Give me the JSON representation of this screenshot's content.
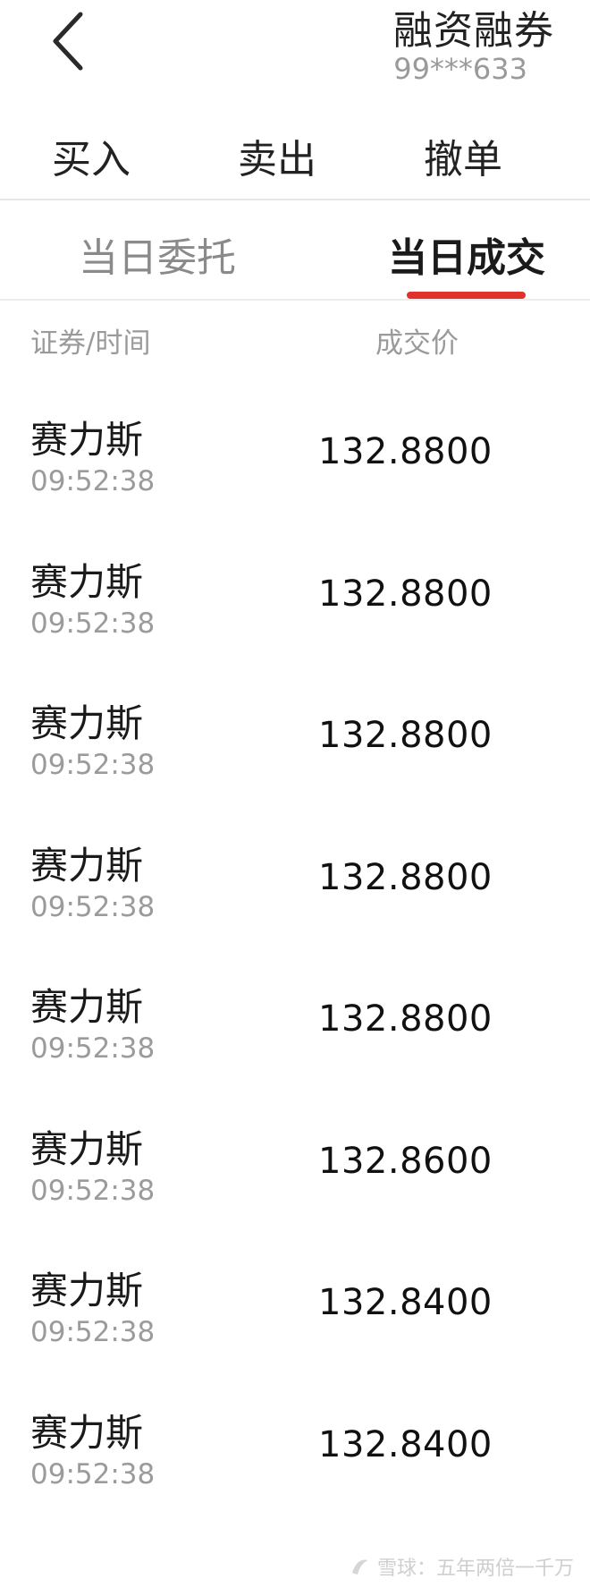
{
  "header": {
    "title": "融资融券",
    "account": "99***633"
  },
  "actions": [
    "买入",
    "卖出",
    "撤单"
  ],
  "tabs": {
    "left": "当日委托",
    "right": "当日成交"
  },
  "columns": {
    "left": "证券/时间",
    "right": "成交价"
  },
  "rows": [
    {
      "name": "赛力斯",
      "time": "09:52:38",
      "price": "132.8800"
    },
    {
      "name": "赛力斯",
      "time": "09:52:38",
      "price": "132.8800"
    },
    {
      "name": "赛力斯",
      "time": "09:52:38",
      "price": "132.8800"
    },
    {
      "name": "赛力斯",
      "time": "09:52:38",
      "price": "132.8800"
    },
    {
      "name": "赛力斯",
      "time": "09:52:38",
      "price": "132.8800"
    },
    {
      "name": "赛力斯",
      "time": "09:52:38",
      "price": "132.8600"
    },
    {
      "name": "赛力斯",
      "time": "09:52:38",
      "price": "132.8400"
    },
    {
      "name": "赛力斯",
      "time": "09:52:38",
      "price": "132.8400"
    }
  ],
  "watermark": "雪球：五年两倍一千万",
  "colors": {
    "accent": "#e0312b",
    "muted_text": "#9a9a9a"
  },
  "icons": {
    "back": "chevron-left-icon",
    "watermark": "snowball-logo-icon"
  }
}
